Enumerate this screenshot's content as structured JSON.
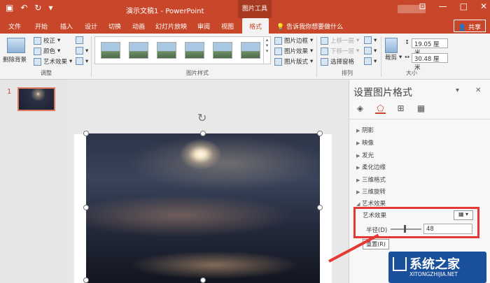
{
  "titlebar": {
    "doc_title": "演示文稿1 - PowerPoint",
    "tools_tab": "图片工具",
    "share": "共享",
    "minimize": "—",
    "restore": "□",
    "close": "✕",
    "ribbon_opts": "⊡"
  },
  "tabs": [
    "文件",
    "开始",
    "插入",
    "设计",
    "切换",
    "动画",
    "幻灯片放映",
    "审阅",
    "视图",
    "格式"
  ],
  "tell_me": "告诉我你想要做什么",
  "ribbon": {
    "remove_bg": "删除背景",
    "correct": "校正",
    "color": "颜色",
    "artistic": "艺术效果",
    "adjust_label": "调整",
    "styles_label": "图片样式",
    "border": "图片边框",
    "effects": "图片效果",
    "layout": "图片版式",
    "bring_fwd": "上移一层",
    "send_back": "下移一层",
    "select_pane": "选择窗格",
    "arrange_label": "排列",
    "crop": "裁剪",
    "height": "19.05 厘米",
    "width": "30.48 厘米",
    "size_label": "大小"
  },
  "slides": {
    "number": "1"
  },
  "pane": {
    "title": "设置图片格式",
    "close": "✕",
    "menu": "▾",
    "sections": [
      "阴影",
      "映像",
      "发光",
      "柔化边缘",
      "三维格式",
      "三维旋转",
      "艺术效果"
    ],
    "artistic_label": "艺术效果",
    "radius_label": "半径(D)",
    "radius_value": "48",
    "reset": "重置(R)"
  },
  "watermark": {
    "logo": "系统之家",
    "url": "XITONGZHIJIA.NET"
  }
}
